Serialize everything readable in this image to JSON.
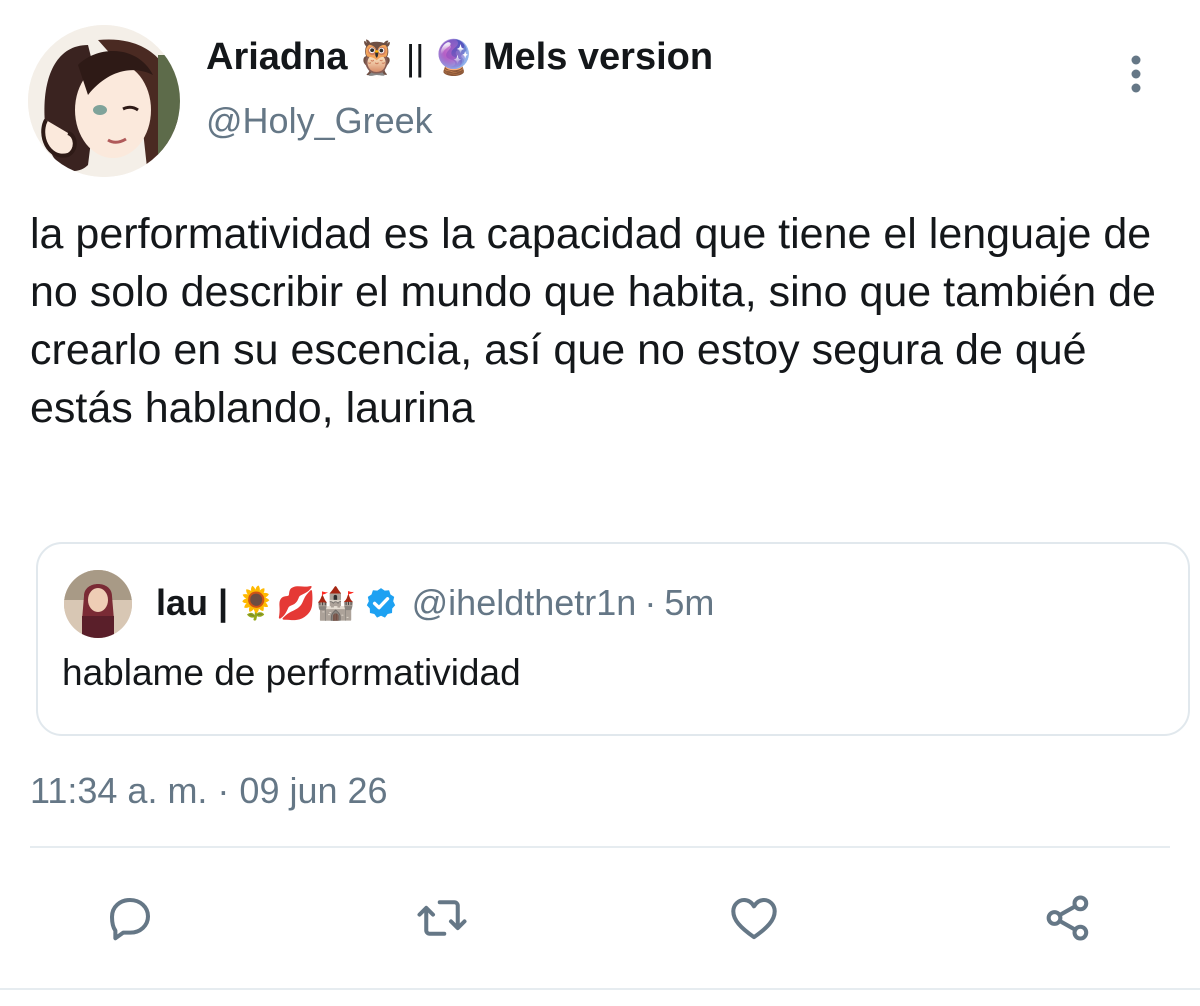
{
  "tweet": {
    "author_name": "Ariadna",
    "author_emoji_1": "🦉",
    "author_separator": "||",
    "author_emoji_2": "🔮",
    "author_suffix": "Mels version",
    "handle": "@Holy_Greek",
    "text": "la performatividad es la capacidad que tiene el lenguaje de no solo describir el mundo que habita, sino que también de crearlo en su escencia, así que no estoy segura de qué estás hablando, laurina",
    "timestamp": "11:34 a. m. · 09 jun 26"
  },
  "quoted": {
    "name": "lau |",
    "emojis": "🌻💋🏰",
    "handle": "@iheldthetr1n",
    "dot": "·",
    "time": "5m",
    "text": "hablame de performatividad"
  },
  "icons": {
    "more": "more-vertical-icon",
    "reply": "reply-icon",
    "retweet": "retweet-icon",
    "like": "heart-icon",
    "share": "share-icon",
    "verified": "verified-badge-icon"
  },
  "colors": {
    "accent": "#1da1f2",
    "icon_gray": "#657786",
    "text": "#14171a",
    "border": "#e1e8ed"
  }
}
